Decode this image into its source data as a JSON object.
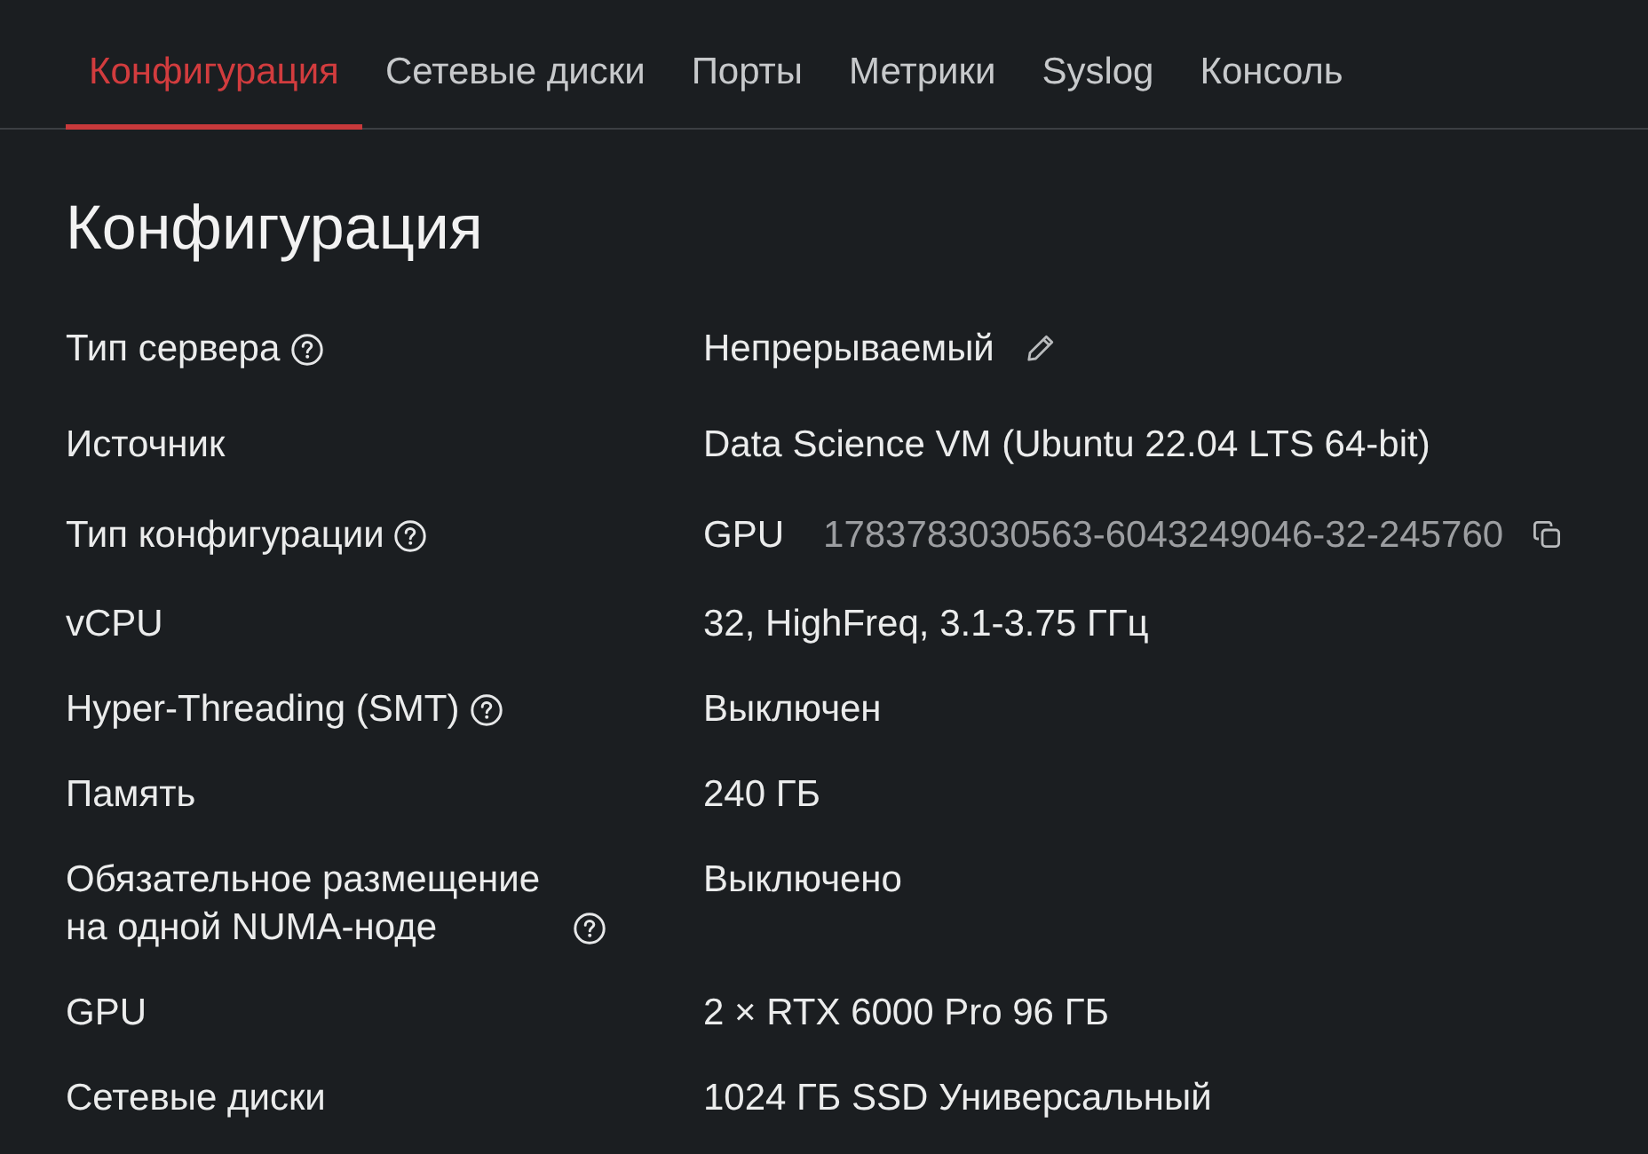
{
  "tabs": [
    {
      "label": "Конфигурация",
      "selected": true
    },
    {
      "label": "Сетевые диски",
      "selected": false
    },
    {
      "label": "Порты",
      "selected": false
    },
    {
      "label": "Метрики",
      "selected": false
    },
    {
      "label": "Syslog",
      "selected": false
    },
    {
      "label": "Консоль",
      "selected": false
    }
  ],
  "section": {
    "title": "Конфигурация"
  },
  "properties": [
    {
      "label": "Тип сервера",
      "help": true,
      "kind": "editable",
      "value": "Непрерываемый"
    },
    {
      "label": "Источник",
      "help": false,
      "kind": "text",
      "value": "Data Science VM (Ubuntu 22.04 LTS 64-bit)"
    },
    {
      "label": "Тип конфигурации",
      "help": true,
      "kind": "id",
      "value": "GPU",
      "id": "1783783030563-6043249046-32-245760"
    },
    {
      "label": "vCPU",
      "help": false,
      "kind": "text",
      "value": "32, HighFreq, 3.1-3.75 ГГц"
    },
    {
      "label": "Hyper-Threading (SMT)",
      "help": true,
      "kind": "text",
      "value": "Выключен"
    },
    {
      "label": "Память",
      "help": false,
      "kind": "text",
      "value": "240 ГБ"
    },
    {
      "label": "Обязательное размещение на одной NUMA-ноде",
      "help": true,
      "kind": "text",
      "value": "Выключено"
    },
    {
      "label": "GPU",
      "help": false,
      "kind": "text",
      "value": "2 × RTX 6000 Pro 96 ГБ"
    },
    {
      "label": "Сетевые диски",
      "help": false,
      "kind": "text",
      "value": "1024 ГБ SSD Универсальный"
    }
  ]
}
